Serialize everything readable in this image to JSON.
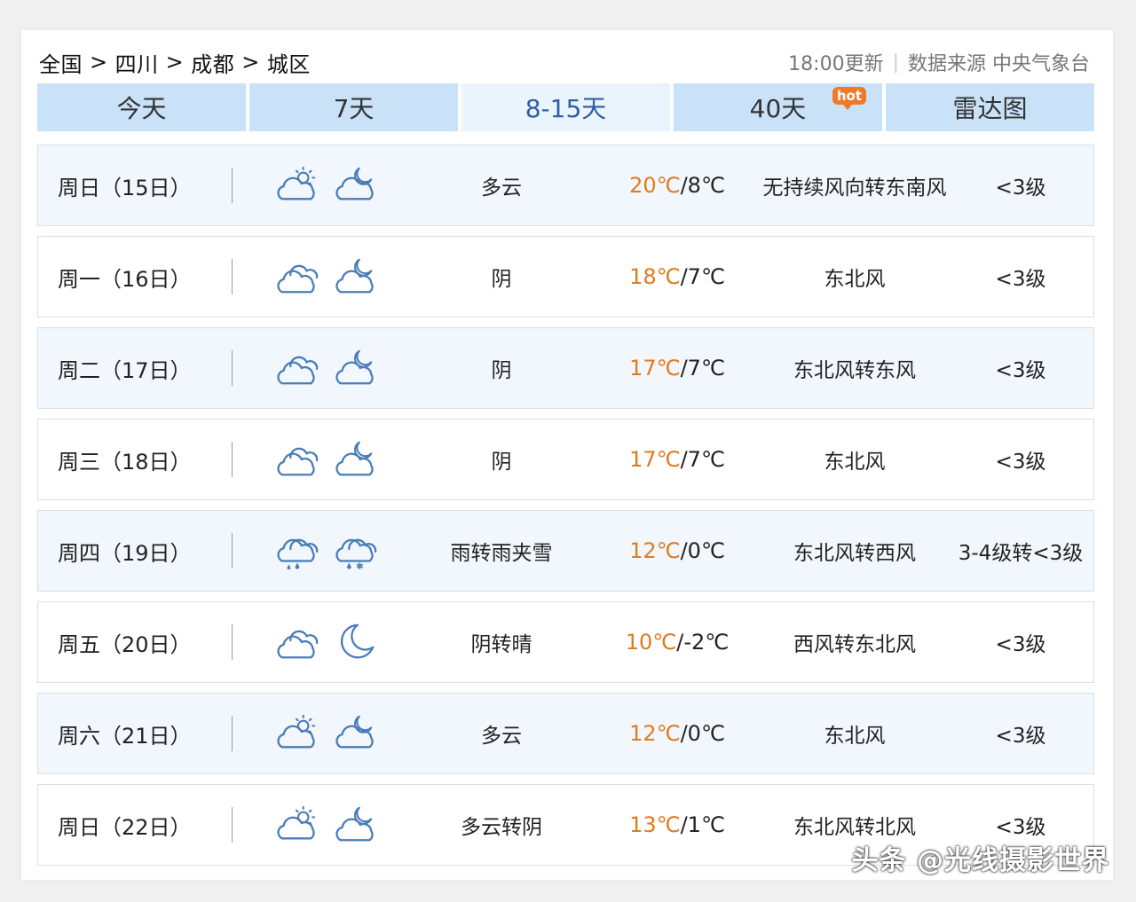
{
  "breadcrumb": [
    "全国",
    "四川",
    "成都",
    "城区"
  ],
  "breadcrumb_sep": ">",
  "update_time": "18:00更新",
  "source": "数据来源 中央气象台",
  "tabs": [
    {
      "label": "今天"
    },
    {
      "label": "7天"
    },
    {
      "label": "8-15天"
    },
    {
      "label": "40天",
      "badge": "hot"
    },
    {
      "label": "雷达图"
    }
  ],
  "active_tab": 2,
  "colors": {
    "tab_bg": "#c9e2f8",
    "tab_active_text": "#2e5fa5",
    "temp_high": "#e07a1f",
    "hot_badge": "#f07a2a"
  },
  "days": [
    {
      "date": "周日（15日）",
      "day_icon": "partly-cloudy-sun-icon",
      "night_icon": "partly-cloudy-moon-icon",
      "desc": "多云",
      "high": "20℃",
      "low": "/8℃",
      "wind": "无持续风向转东南风",
      "level": "<3级"
    },
    {
      "date": "周一（16日）",
      "day_icon": "cloudy-icon",
      "night_icon": "overcast-moon-icon",
      "desc": "阴",
      "high": "18℃",
      "low": "/7℃",
      "wind": "东北风",
      "level": "<3级"
    },
    {
      "date": "周二（17日）",
      "day_icon": "cloudy-icon",
      "night_icon": "overcast-moon-icon",
      "desc": "阴",
      "high": "17℃",
      "low": "/7℃",
      "wind": "东北风转东风",
      "level": "<3级"
    },
    {
      "date": "周三（18日）",
      "day_icon": "cloudy-icon",
      "night_icon": "overcast-moon-icon",
      "desc": "阴",
      "high": "17℃",
      "low": "/7℃",
      "wind": "东北风",
      "level": "<3级"
    },
    {
      "date": "周四（19日）",
      "day_icon": "rain-icon",
      "night_icon": "sleet-icon",
      "desc": "雨转雨夹雪",
      "high": "12℃",
      "low": "/0℃",
      "wind": "东北风转西风",
      "level": "3-4级转<3级"
    },
    {
      "date": "周五（20日）",
      "day_icon": "cloudy-icon",
      "night_icon": "moon-icon",
      "desc": "阴转晴",
      "high": "10℃",
      "low": "/-2℃",
      "wind": "西风转东北风",
      "level": "<3级"
    },
    {
      "date": "周六（21日）",
      "day_icon": "partly-cloudy-sun-icon",
      "night_icon": "partly-cloudy-moon-icon",
      "desc": "多云",
      "high": "12℃",
      "low": "/0℃",
      "wind": "东北风",
      "level": "<3级"
    },
    {
      "date": "周日（22日）",
      "day_icon": "partly-cloudy-sun-icon",
      "night_icon": "overcast-moon-icon",
      "desc": "多云转阴",
      "high": "13℃",
      "low": "/1℃",
      "wind": "东北风转北风",
      "level": "<3级"
    }
  ],
  "watermark": "头条 @光线摄影世界"
}
